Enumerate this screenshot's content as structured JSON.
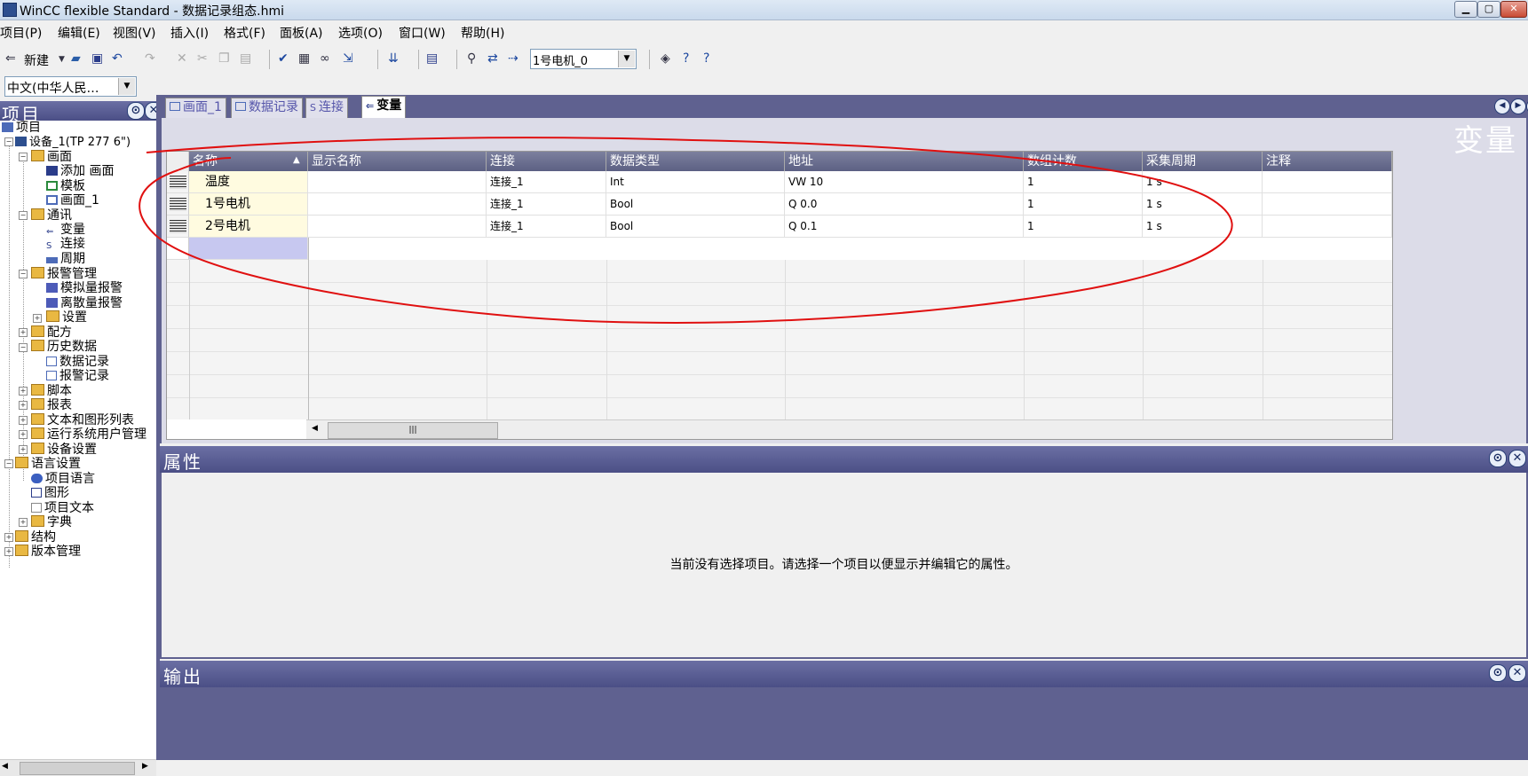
{
  "window": {
    "title": "WinCC flexible Standard - 数据记录组态.hmi"
  },
  "menu": [
    "项目(P)",
    "编辑(E)",
    "视图(V)",
    "插入(I)",
    "格式(F)",
    "面板(A)",
    "选项(O)",
    "窗口(W)",
    "帮助(H)"
  ],
  "toolbar": {
    "new_label": "新建",
    "device_combo": "1号电机_0",
    "language_combo": "中文(中华人民…"
  },
  "project_pane": {
    "title": "项目",
    "tree": [
      "项目",
      "设备_1(TP 277 6\")",
      "画面",
      "添加 画面",
      "模板",
      "画面_1",
      "通讯",
      "变量",
      "连接",
      "周期",
      "报警管理",
      "模拟量报警",
      "离散量报警",
      "设置",
      "配方",
      "历史数据",
      "数据记录",
      "报警记录",
      "脚本",
      "报表",
      "文本和图形列表",
      "运行系统用户管理",
      "设备设置",
      "语言设置",
      "项目语言",
      "图形",
      "项目文本",
      "字典",
      "结构",
      "版本管理"
    ]
  },
  "editor": {
    "tabs": [
      "画面_1",
      "数据记录",
      "连接",
      "变量"
    ],
    "heading": "变量",
    "columns": [
      "名称",
      "显示名称",
      "连接",
      "数据类型",
      "地址",
      "数组计数",
      "采集周期",
      "注释"
    ],
    "rows": [
      {
        "name": "温度",
        "display_name": "",
        "connection": "连接_1",
        "data_type": "Int",
        "address": "VW 10",
        "array_count": "1",
        "cycle": "1 s",
        "comment": ""
      },
      {
        "name": "1号电机",
        "display_name": "",
        "connection": "连接_1",
        "data_type": "Bool",
        "address": "Q 0.0",
        "array_count": "1",
        "cycle": "1 s",
        "comment": ""
      },
      {
        "name": "2号电机",
        "display_name": "",
        "connection": "连接_1",
        "data_type": "Bool",
        "address": "Q 0.1",
        "array_count": "1",
        "cycle": "1 s",
        "comment": ""
      }
    ]
  },
  "properties": {
    "title": "属性",
    "message": "当前没有选择项目。请选择一个项目以便显示并编辑它的属性。"
  },
  "output": {
    "title": "输出"
  }
}
